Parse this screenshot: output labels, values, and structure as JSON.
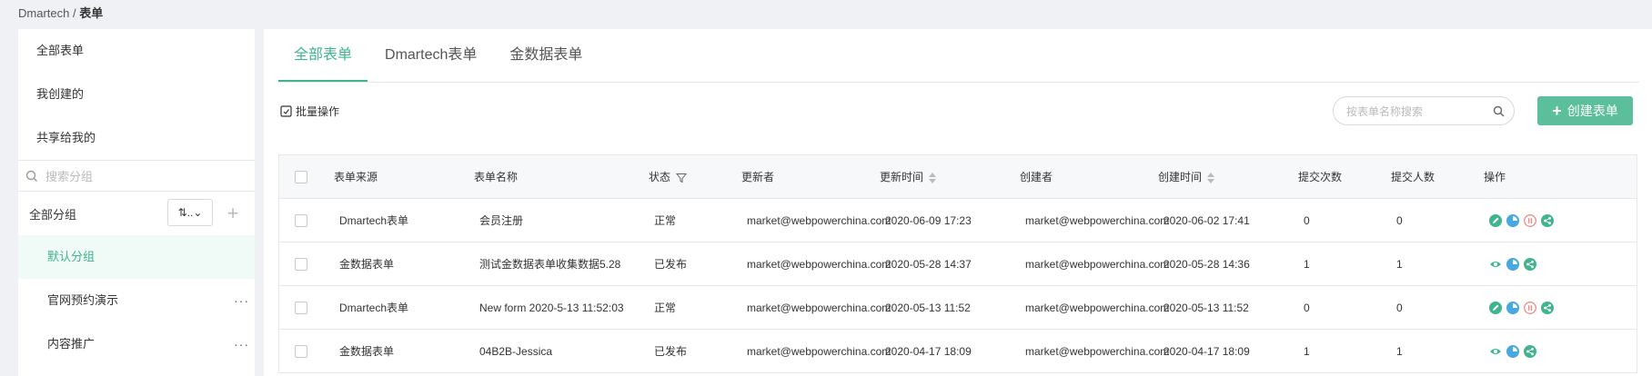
{
  "breadcrumb": {
    "root": "Dmartech",
    "sep": " / ",
    "current": "表单"
  },
  "sidebar": {
    "items": [
      {
        "label": "全部表单"
      },
      {
        "label": "我创建的"
      },
      {
        "label": "共享给我的"
      }
    ],
    "search_placeholder": "搜索分组",
    "group_header": "全部分组",
    "sort_select": "⇅..⌄",
    "groups": [
      {
        "label": "默认分组",
        "active": true
      },
      {
        "label": "官网预约演示",
        "more": "···"
      },
      {
        "label": "内容推广",
        "more": "···"
      }
    ]
  },
  "tabs": [
    {
      "label": "全部表单",
      "active": true
    },
    {
      "label": "Dmartech表单"
    },
    {
      "label": "金数据表单"
    }
  ],
  "toolbar": {
    "batch_label": "批量操作",
    "search_placeholder": "按表单名称搜索",
    "create_label": "创建表单"
  },
  "table": {
    "headers": {
      "source": "表单来源",
      "name": "表单名称",
      "status": "状态",
      "updater": "更新者",
      "updated_at": "更新时间",
      "creator": "创建者",
      "created_at": "创建时间",
      "submit_count": "提交次数",
      "submit_users": "提交人数",
      "actions": "操作"
    },
    "rows": [
      {
        "source": "Dmartech表单",
        "name": "会员注册",
        "status": "正常",
        "updater": "market@webpowerchina.com",
        "updated_at": "2020-06-09 17:23",
        "creator": "market@webpowerchina.com",
        "created_at": "2020-06-02 17:41",
        "submit_count": "0",
        "submit_users": "0",
        "actions": [
          "edit-icon",
          "stats-icon",
          "pause-icon",
          "share-icon"
        ]
      },
      {
        "source": "金数据表单",
        "name": "测试金数据表单收集数据5.28",
        "status": "已发布",
        "updater": "market@webpowerchina.com",
        "updated_at": "2020-05-28 14:37",
        "creator": "market@webpowerchina.com",
        "created_at": "2020-05-28 14:36",
        "submit_count": "1",
        "submit_users": "1",
        "actions": [
          "view-icon",
          "stats-icon",
          "share-icon"
        ]
      },
      {
        "source": "Dmartech表单",
        "name": "New form 2020-5-13 11:52:03",
        "status": "正常",
        "updater": "market@webpowerchina.com",
        "updated_at": "2020-05-13 11:52",
        "creator": "market@webpowerchina.com",
        "created_at": "2020-05-13 11:52",
        "submit_count": "0",
        "submit_users": "0",
        "actions": [
          "edit-icon",
          "stats-icon",
          "pause-icon",
          "share-icon"
        ]
      },
      {
        "source": "金数据表单",
        "name": "04B2B-Jessica",
        "status": "已发布",
        "updater": "market@webpowerchina.com",
        "updated_at": "2020-04-17 18:09",
        "creator": "market@webpowerchina.com",
        "created_at": "2020-04-17 18:09",
        "submit_count": "1",
        "submit_users": "1",
        "actions": [
          "view-icon",
          "stats-icon",
          "share-icon"
        ]
      }
    ]
  },
  "colors": {
    "accent": "#3fb58c",
    "button": "#5bbf9c",
    "pause": "#f08a8a",
    "stats": "#4aa8e0"
  }
}
